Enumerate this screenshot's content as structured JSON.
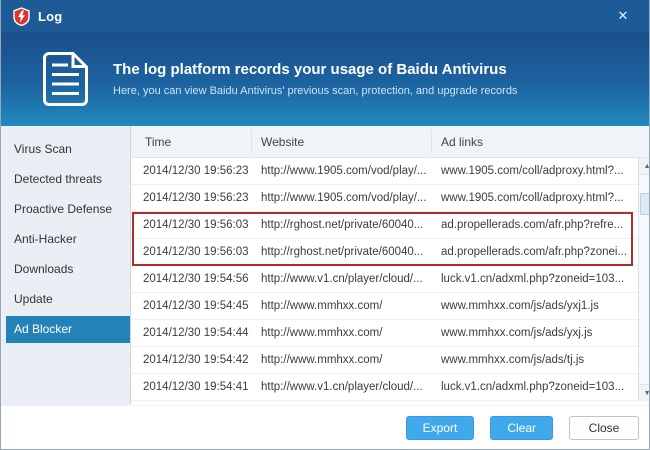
{
  "window": {
    "title": "Log"
  },
  "titlebar": {
    "close_icon": "✕"
  },
  "banner": {
    "title": "The log platform records your usage of Baidu Antivirus",
    "subtitle": "Here, you can view Baidu Antivirus' previous scan, protection, and upgrade records"
  },
  "sidebar": {
    "items": [
      {
        "label": "Virus Scan",
        "selected": false
      },
      {
        "label": "Detected threats",
        "selected": false
      },
      {
        "label": "Proactive Defense",
        "selected": false
      },
      {
        "label": "Anti-Hacker",
        "selected": false
      },
      {
        "label": "Downloads",
        "selected": false
      },
      {
        "label": "Update",
        "selected": false
      },
      {
        "label": "Ad Blocker",
        "selected": true
      }
    ]
  },
  "table": {
    "columns": [
      "Time",
      "Website",
      "Ad links"
    ],
    "rows": [
      {
        "time": "2014/12/30 19:56:23",
        "website": "http://www.1905.com/vod/play/...",
        "ad_link": "www.1905.com/coll/adproxy.html?...",
        "highlighted": false
      },
      {
        "time": "2014/12/30 19:56:23",
        "website": "http://www.1905.com/vod/play/...",
        "ad_link": "www.1905.com/coll/adproxy.html?...",
        "highlighted": false
      },
      {
        "time": "2014/12/30 19:56:03",
        "website": "http://rghost.net/private/60040...",
        "ad_link": "ad.propellerads.com/afr.php?refre...",
        "highlighted": true
      },
      {
        "time": "2014/12/30 19:56:03",
        "website": "http://rghost.net/private/60040...",
        "ad_link": "ad.propellerads.com/afr.php?zonei...",
        "highlighted": true
      },
      {
        "time": "2014/12/30 19:54:56",
        "website": "http://www.v1.cn/player/cloud/...",
        "ad_link": "luck.v1.cn/adxml.php?zoneid=103...",
        "highlighted": false
      },
      {
        "time": "2014/12/30 19:54:45",
        "website": "http://www.mmhxx.com/",
        "ad_link": "www.mmhxx.com/js/ads/yxj1.js",
        "highlighted": false
      },
      {
        "time": "2014/12/30 19:54:44",
        "website": "http://www.mmhxx.com/",
        "ad_link": "www.mmhxx.com/js/ads/yxj.js",
        "highlighted": false
      },
      {
        "time": "2014/12/30 19:54:42",
        "website": "http://www.mmhxx.com/",
        "ad_link": "www.mmhxx.com/js/ads/tj.js",
        "highlighted": false
      },
      {
        "time": "2014/12/30 19:54:41",
        "website": "http://www.v1.cn/player/cloud/...",
        "ad_link": "luck.v1.cn/adxml.php?zoneid=103...",
        "highlighted": false
      }
    ]
  },
  "scrollbar": {
    "up_icon": "▲",
    "down_icon": "▼"
  },
  "footer": {
    "buttons": [
      {
        "label": "Export",
        "style": "primary"
      },
      {
        "label": "Clear",
        "style": "primary"
      },
      {
        "label": "Close",
        "style": "default"
      }
    ]
  },
  "colors": {
    "titlebar": "#1e5a96",
    "banner_top": "#1a4e8a",
    "banner_bottom": "#2189bd",
    "selected_item": "#2383b9",
    "primary_button": "#3fa9ec",
    "highlight_border": "#b02b2b"
  }
}
